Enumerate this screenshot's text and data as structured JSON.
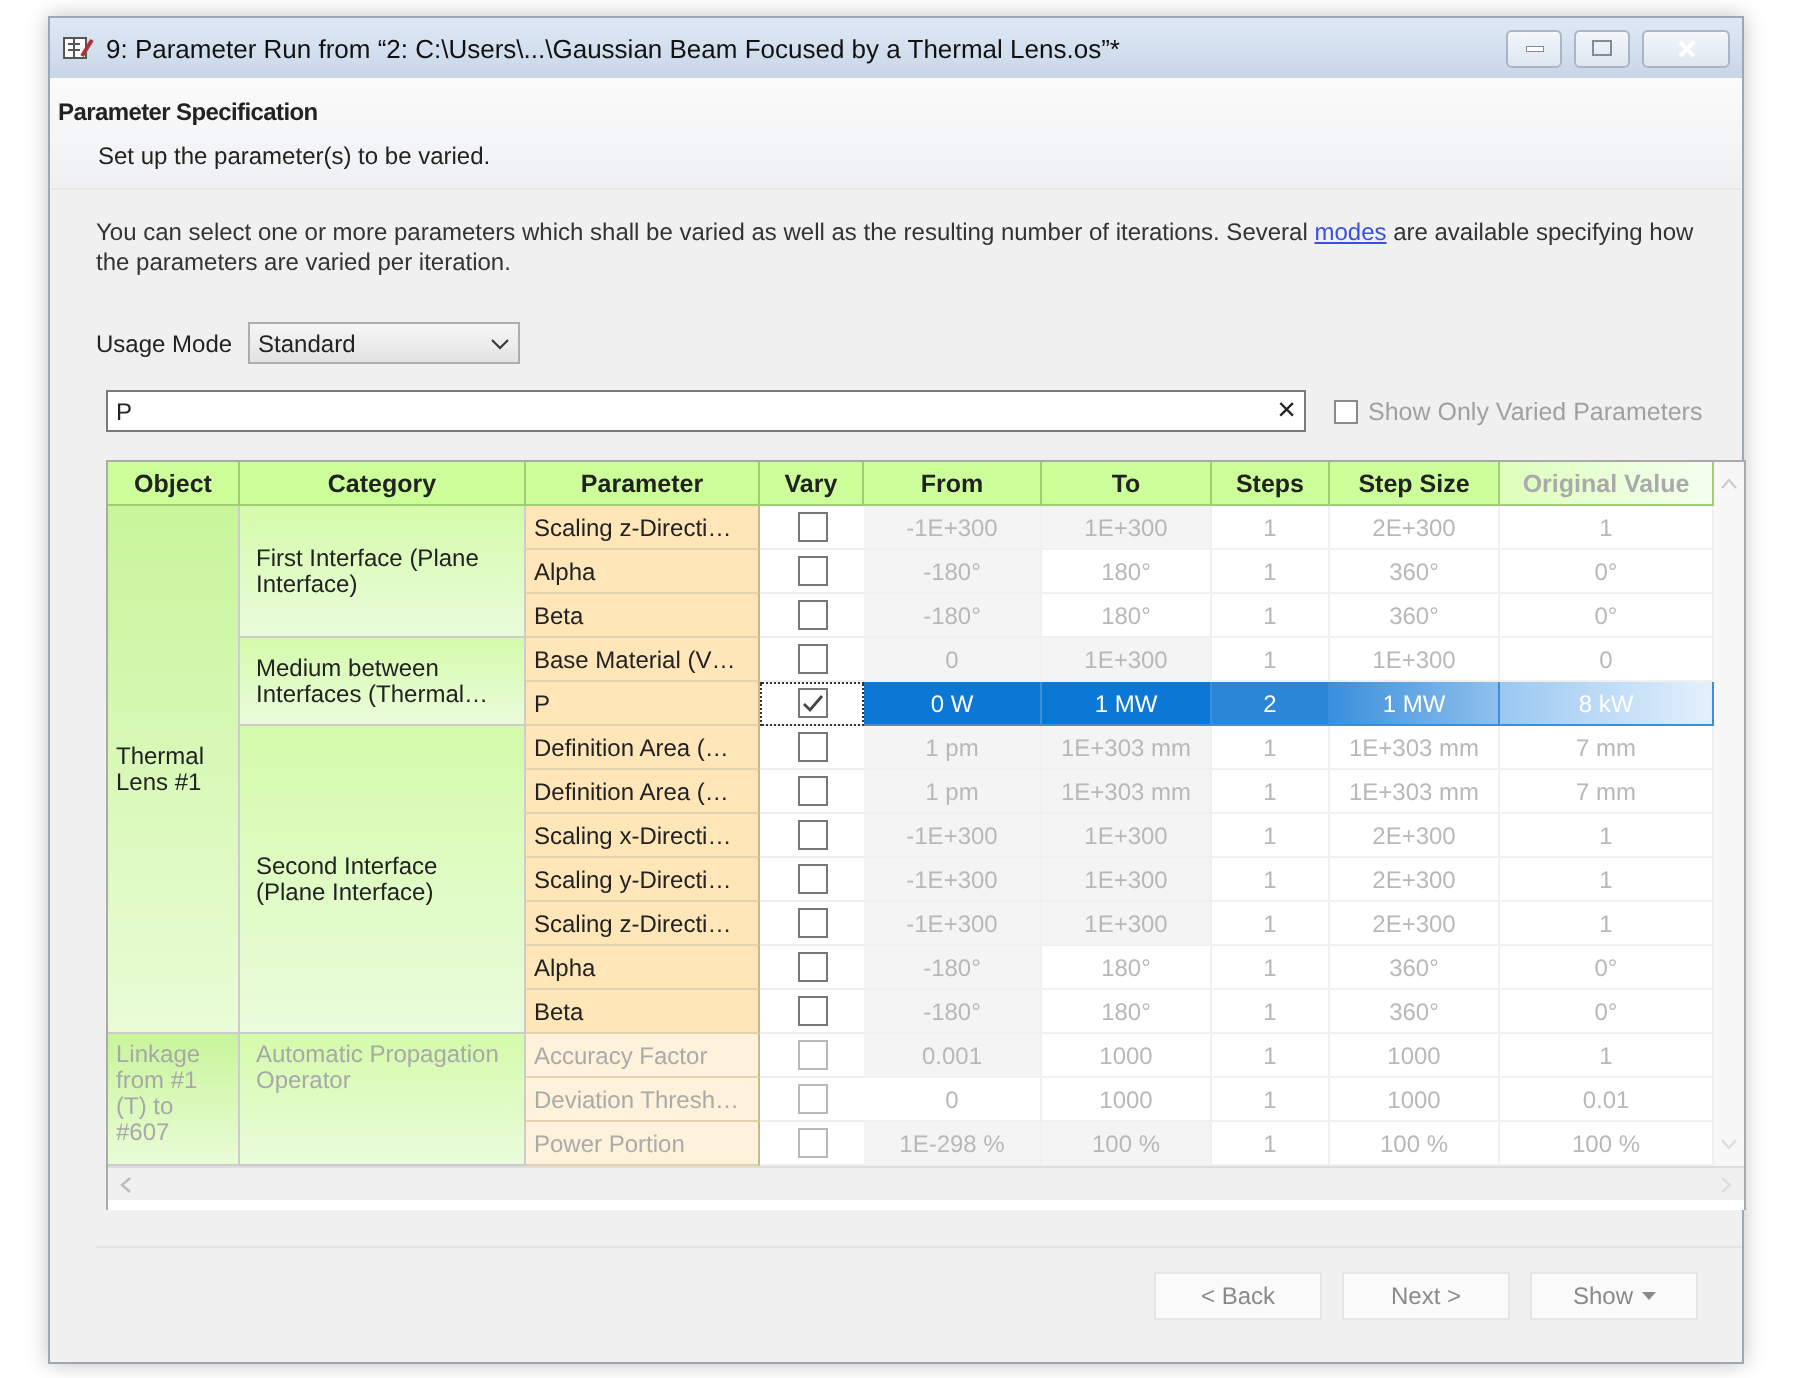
{
  "window": {
    "title": "9: Parameter Run from “2: C:\\Users\\...\\Gaussian Beam Focused by a Thermal Lens.os”*"
  },
  "header": {
    "title": "Parameter Specification",
    "subtitle": "Set up the parameter(s) to be varied."
  },
  "intro": {
    "text": "You can select one or more parameters which shall be varied as well as the resulting number of iterations. Several ",
    "link": "modes",
    "text_after": " are available specifying how the parameters are varied per iteration."
  },
  "usage_mode": {
    "label": "Usage Mode",
    "value": "Standard"
  },
  "filter": {
    "value": "P",
    "clear": "×"
  },
  "show_only_varied": {
    "label": "Show Only Varied Parameters",
    "checked": false
  },
  "table": {
    "columns": [
      "Object",
      "Category",
      "Parameter",
      "Vary",
      "From",
      "To",
      "Steps",
      "Step Size",
      "Original Value"
    ],
    "groups": [
      {
        "object": "Thermal Lens #1",
        "disabled": false,
        "categories": [
          {
            "name": "First Interface (Plane Interface)",
            "rows": [
              {
                "parameter": "Scaling z-Directi…",
                "vary": false,
                "selected": false,
                "from": "-1E+300",
                "to": "1E+300",
                "steps": "1",
                "step_size": "2E+300",
                "original": "1"
              },
              {
                "parameter": "Alpha",
                "vary": false,
                "selected": false,
                "from": "-180°",
                "to": "180°",
                "steps": "1",
                "step_size": "360°",
                "original": "0°"
              },
              {
                "parameter": "Beta",
                "vary": false,
                "selected": false,
                "from": "-180°",
                "to": "180°",
                "steps": "1",
                "step_size": "360°",
                "original": "0°"
              }
            ]
          },
          {
            "name": "Medium between Interfaces (Thermal…",
            "rows": [
              {
                "parameter": "Base Material (V…",
                "vary": false,
                "selected": false,
                "from": "0",
                "to": "1E+300",
                "steps": "1",
                "step_size": "1E+300",
                "original": "0"
              },
              {
                "parameter": "P",
                "vary": true,
                "selected": true,
                "from": "0 W",
                "to": "1 MW",
                "steps": "2",
                "step_size": "1 MW",
                "original": "8 kW"
              }
            ]
          },
          {
            "name": "Second Interface (Plane Interface)",
            "rows": [
              {
                "parameter": "Definition Area (…",
                "vary": false,
                "selected": false,
                "from": "1 pm",
                "to": "1E+303 mm",
                "steps": "1",
                "step_size": "1E+303 mm",
                "original": "7 mm"
              },
              {
                "parameter": "Definition Area (…",
                "vary": false,
                "selected": false,
                "from": "1 pm",
                "to": "1E+303 mm",
                "steps": "1",
                "step_size": "1E+303 mm",
                "original": "7 mm"
              },
              {
                "parameter": "Scaling x-Directi…",
                "vary": false,
                "selected": false,
                "from": "-1E+300",
                "to": "1E+300",
                "steps": "1",
                "step_size": "2E+300",
                "original": "1"
              },
              {
                "parameter": "Scaling y-Directi…",
                "vary": false,
                "selected": false,
                "from": "-1E+300",
                "to": "1E+300",
                "steps": "1",
                "step_size": "2E+300",
                "original": "1"
              },
              {
                "parameter": "Scaling z-Directi…",
                "vary": false,
                "selected": false,
                "from": "-1E+300",
                "to": "1E+300",
                "steps": "1",
                "step_size": "2E+300",
                "original": "1"
              },
              {
                "parameter": "Alpha",
                "vary": false,
                "selected": false,
                "from": "-180°",
                "to": "180°",
                "steps": "1",
                "step_size": "360°",
                "original": "0°"
              },
              {
                "parameter": "Beta",
                "vary": false,
                "selected": false,
                "from": "-180°",
                "to": "180°",
                "steps": "1",
                "step_size": "360°",
                "original": "0°"
              }
            ]
          }
        ]
      },
      {
        "object": "Linkage from #1 (T) to #607",
        "disabled": true,
        "categories": [
          {
            "name": "Automatic Propagation Operator",
            "rows": [
              {
                "parameter": "Accuracy Factor",
                "vary": false,
                "selected": false,
                "from": "0.001",
                "to": "1000",
                "steps": "1",
                "step_size": "1000",
                "original": "1"
              },
              {
                "parameter": "Deviation Thresh…",
                "vary": false,
                "selected": false,
                "from": "0",
                "to": "1000",
                "steps": "1",
                "step_size": "1000",
                "original": "0.01"
              },
              {
                "parameter": "Power Portion",
                "vary": false,
                "selected": false,
                "from": "1E-298 %",
                "to": "100 %",
                "steps": "1",
                "step_size": "100 %",
                "original": "100 %"
              }
            ]
          }
        ]
      }
    ]
  },
  "buttons": [
    {
      "label": "< Back",
      "kind": "plain"
    },
    {
      "label": "Next >",
      "kind": "plain"
    },
    {
      "label": "Show",
      "kind": "dropdown"
    }
  ]
}
